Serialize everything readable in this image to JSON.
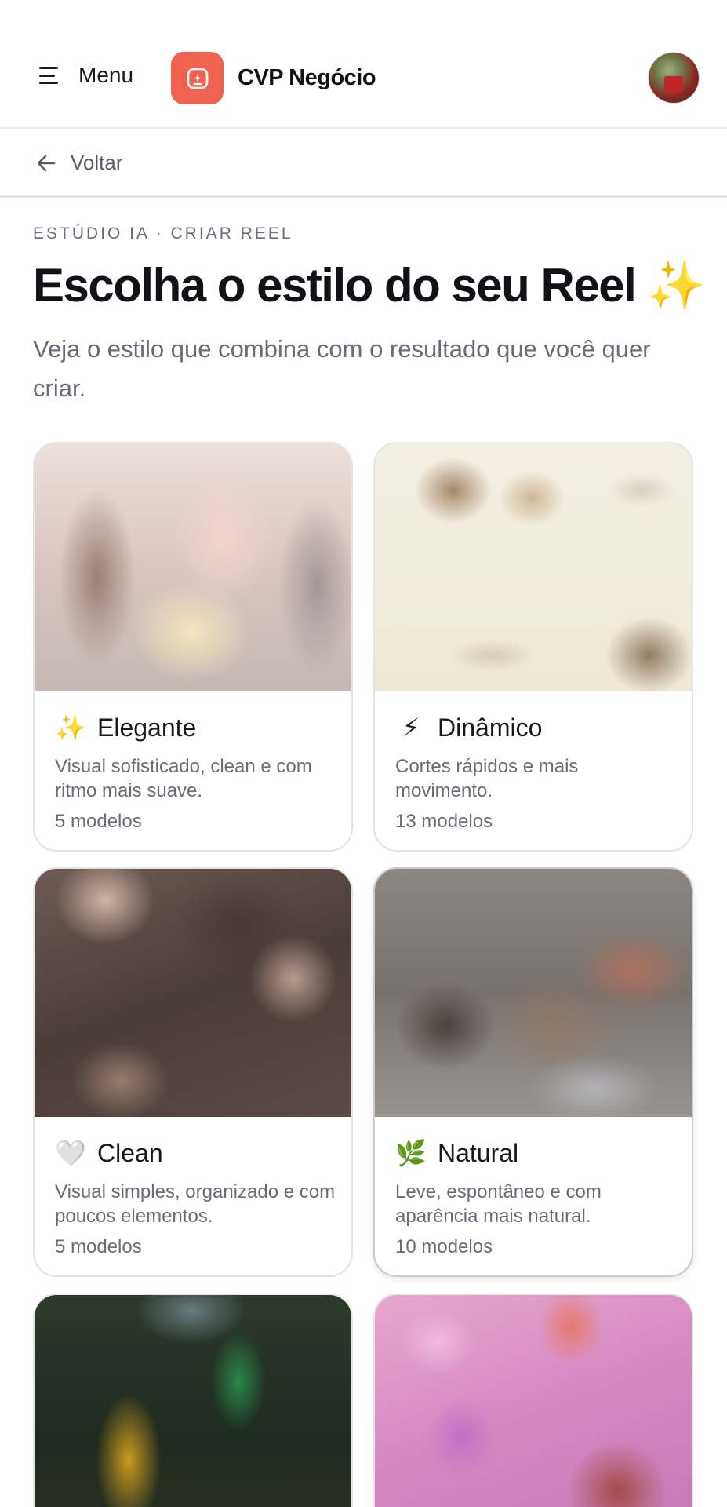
{
  "header": {
    "menu_label": "Menu",
    "brand_name": "CVP Negócio",
    "brand_color": "#ef6250"
  },
  "nav": {
    "back_label": "Voltar"
  },
  "intro": {
    "eyebrow": "ESTÚDIO IA · CRIAR REEL",
    "title": "Escolha o estilo do seu Reel ✨",
    "subtitle": "Veja o estilo que combina com o resultado que você quer criar."
  },
  "styles": [
    {
      "emoji": "✨",
      "title": "Elegante",
      "description": "Visual sofisticado, clean e com ritmo mais suave.",
      "count": "5 modelos"
    },
    {
      "emoji": "⚡",
      "title": "Dinâmico",
      "description": "Cortes rápidos e mais movimento.",
      "count": "13 modelos"
    },
    {
      "emoji": "🤍",
      "title": "Clean",
      "description": "Visual simples, organizado e com poucos elementos.",
      "count": "5 modelos"
    },
    {
      "emoji": "🌿",
      "title": "Natural",
      "description": "Leve, espontâneo e com aparência mais natural.",
      "count": "10 modelos"
    }
  ]
}
